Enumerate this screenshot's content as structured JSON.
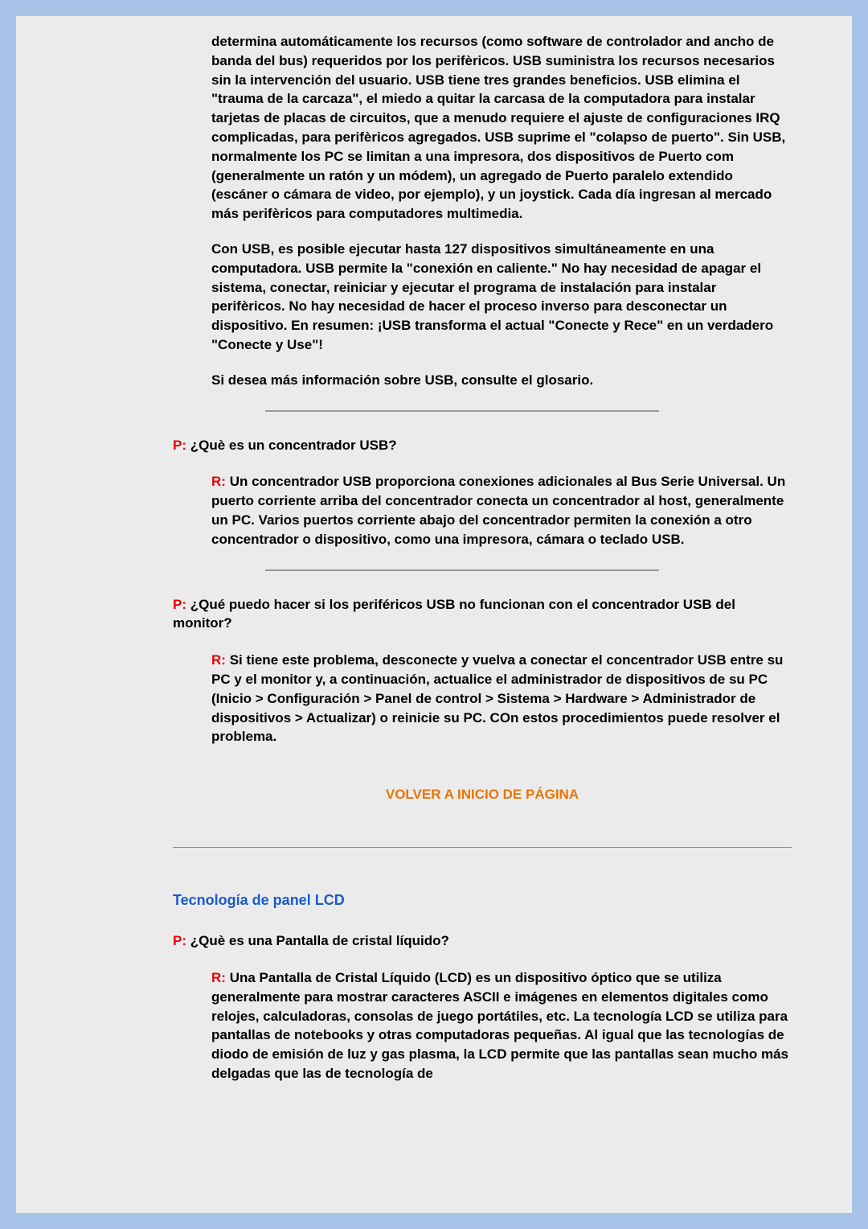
{
  "usbIntro": {
    "para1": "determina automáticamente los recursos (como software de controlador and ancho de banda del bus) requeridos por los perifèricos. USB suministra los recursos necesarios sin la intervención del usuario. USB tiene tres grandes beneficios. USB elimina el \"trauma de la carcaza\", el miedo a quitar la carcasa de la computadora para instalar tarjetas de placas de circuitos, que a menudo requiere el ajuste de configuraciones IRQ complicadas, para perifèricos agregados. USB suprime el \"colapso de puerto\". Sin USB, normalmente los PC se limitan a una impresora, dos dispositivos de Puerto com (generalmente un ratón y un módem), un agregado de Puerto paralelo extendido (escáner o cámara de video, por ejemplo), y un joystick. Cada día ingresan al mercado más perifèricos para computadores multimedia.",
    "para2": "Con USB, es posible ejecutar hasta 127 dispositivos simultáneamente en una computadora. USB permite la \"conexión en caliente.\" No hay necesidad de apagar el sistema, conectar, reiniciar y ejecutar el programa de instalación para instalar perifèricos. No hay necesidad de hacer el proceso inverso para desconectar un dispositivo. En resumen: ¡USB transforma el actual \"Conecte y Rece\" en un verdadero \"Conecte y Use\"!",
    "para3": "Si desea más información sobre USB, consulte el glosario."
  },
  "q1": {
    "qLabel": "P:",
    "qText": "¿Què es un concentrador USB?",
    "aLabel": "R:",
    "aText": "Un concentrador USB proporciona conexiones adicionales al Bus Serie Universal. Un puerto corriente arriba del concentrador conecta un concentrador al host, generalmente un PC. Varios puertos corriente abajo del concentrador permiten la conexión a otro concentrador o dispositivo, como una impresora, cámara o teclado USB."
  },
  "q2": {
    "qLabel": "P:",
    "qText": "¿Qué puedo hacer si los periféricos USB no funcionan con el concentrador USB del monitor?",
    "aLabel": "R:",
    "aText": "Si tiene este problema, desconecte y vuelva a conectar el concentrador USB entre su PC y el monitor y, a continuación, actualice el administrador de dispositivos de su PC (Inicio > Configuración > Panel de control > Sistema > Hardware > Administrador de dispositivos > Actualizar) o reinicie su PC. COn estos procedimientos puede resolver el problema."
  },
  "backLink": "VOLVER A INICIO DE PÁGINA",
  "sectionTitle": "Tecnología de panel LCD",
  "q3": {
    "qLabel": "P:",
    "qText": "¿Què es una Pantalla de cristal líquido?",
    "aLabel": "R:",
    "aText": "Una Pantalla de Cristal Líquido (LCD) es un dispositivo óptico que se utiliza generalmente para mostrar caracteres ASCII e imágenes en elementos digitales como relojes, calculadoras, consolas de juego portátiles, etc. La tecnología LCD se utiliza para pantallas de notebooks y otras computadoras pequeñas. Al igual que las tecnologías de diodo de emisión de luz y gas plasma, la LCD permite que las pantallas sean mucho más delgadas que las de tecnología de"
  }
}
